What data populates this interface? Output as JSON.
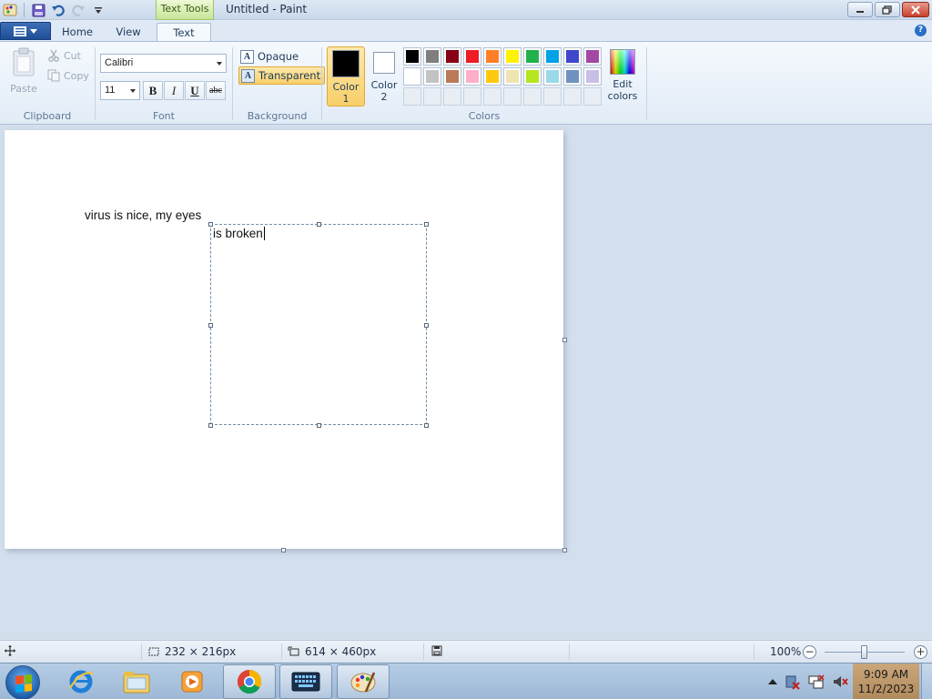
{
  "window": {
    "title": "Untitled - Paint",
    "contextual_tab": "Text Tools"
  },
  "tabs": {
    "home": "Home",
    "view": "View",
    "text": "Text"
  },
  "ribbon": {
    "clipboard": {
      "label": "Clipboard",
      "paste": "Paste",
      "cut": "Cut",
      "copy": "Copy"
    },
    "font": {
      "label": "Font",
      "family": "Calibri",
      "size": "11",
      "bold": "B",
      "italic": "I",
      "underline": "U",
      "strikethrough": "abc"
    },
    "background": {
      "label": "Background",
      "opaque": "Opaque",
      "transparent": "Transparent",
      "selected": "Transparent"
    },
    "colors": {
      "label": "Colors",
      "color1_label_1": "Color",
      "color1_label_2": "1",
      "color1_value": "#000000",
      "color2_label_1": "Color",
      "color2_label_2": "2",
      "color2_value": "#ffffff",
      "edit_label_1": "Edit",
      "edit_label_2": "colors",
      "palette_row1": [
        "#000000",
        "#7f7f7f",
        "#880015",
        "#ed1c24",
        "#ff7f27",
        "#fff200",
        "#22b14c",
        "#00a2e8",
        "#3f48cc",
        "#a349a4"
      ],
      "palette_row2": [
        "#ffffff",
        "#c3c3c3",
        "#b97a57",
        "#ffaec9",
        "#ffc90e",
        "#efe4b0",
        "#b5e61d",
        "#99d9ea",
        "#7092be",
        "#c8bfe7"
      ]
    }
  },
  "canvas": {
    "text_line1": "virus is nice, my eyes",
    "textbox_text": "is broken"
  },
  "status": {
    "selection_size": "232 × 216px",
    "canvas_size": "614 × 460px",
    "zoom": "100%",
    "zoom_level": 1.0
  },
  "taskbar": {
    "time": "9:09 AM",
    "date": "11/2/2023"
  }
}
